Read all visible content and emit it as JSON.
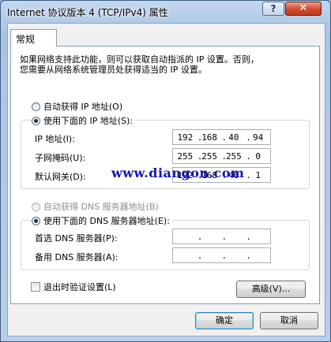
{
  "window": {
    "title": "Internet 协议版本 4 (TCP/IPv4) 属性",
    "help_label": "?",
    "close_label": "✕"
  },
  "tab": {
    "label": "常规"
  },
  "description": {
    "line1": "如果网络支持此功能，则可以获取自动指派的 IP 设置。否则，",
    "line2": "您需要从网络系统管理员处获得适当的 IP 设置。"
  },
  "ip_mode": {
    "auto_label": "自动获得 IP 地址(O)",
    "manual_label": "使用下面的 IP 地址(S):",
    "selected": "manual"
  },
  "ip_fields": [
    {
      "label": "IP 地址(I):",
      "octets": [
        "192",
        "168",
        "40",
        "94"
      ]
    },
    {
      "label": "子网掩码(U):",
      "octets": [
        "255",
        "255",
        "255",
        "0"
      ]
    },
    {
      "label": "默认网关(D):",
      "octets": [
        "192",
        "168",
        "40",
        "1"
      ]
    }
  ],
  "dns_mode": {
    "auto_label": "自动获得 DNS 服务器地址(B)",
    "manual_label": "使用下面的 DNS 服务器地址(E):",
    "selected": "manual"
  },
  "dns_fields": [
    {
      "label": "首选 DNS 服务器(P):",
      "octets": [
        "",
        "",
        "",
        ""
      ]
    },
    {
      "label": "备用 DNS 服务器(A):",
      "octets": [
        "",
        "",
        "",
        ""
      ]
    }
  ],
  "validate_on_exit": {
    "label": "退出时验证设置(L)",
    "checked": false
  },
  "advanced_button": "高级(V)...",
  "ok_button": "确定",
  "cancel_button": "取消",
  "watermark": "www.diangon.com",
  "colors": {
    "accent": "#3c7fb1",
    "watermark": "#1414b8",
    "close": "#c2391d"
  }
}
